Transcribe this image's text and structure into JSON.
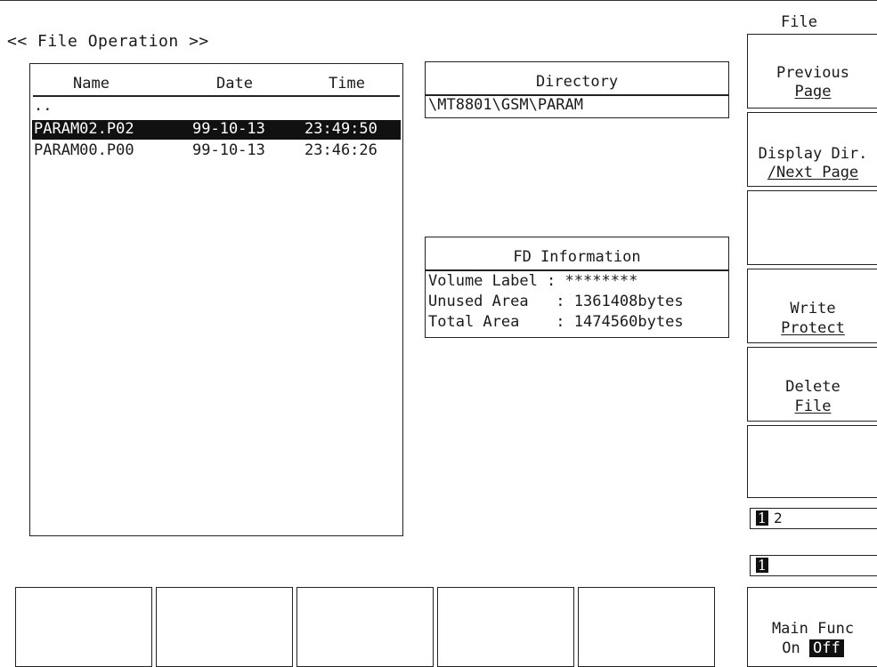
{
  "screen": {
    "title": "<< File Operation >>",
    "softkey_menu_title": "File"
  },
  "file_list": {
    "columns": {
      "name": "Name",
      "date": "Date",
      "time": "Time"
    },
    "parent_entry": "..",
    "rows": [
      {
        "name": "PARAM02.P02",
        "date": "99-10-13",
        "time": "23:49:50",
        "selected": true
      },
      {
        "name": "PARAM00.P00",
        "date": "99-10-13",
        "time": "23:46:26",
        "selected": false
      }
    ]
  },
  "directory": {
    "title": "Directory",
    "path": "\\MT8801\\GSM\\PARAM"
  },
  "fd_info": {
    "title": "FD Information",
    "volume_label": "Volume Label : ********",
    "unused_area": "Unused Area   : 1361408bytes",
    "total_area": "Total Area    : 1474560bytes"
  },
  "softkeys": {
    "previous_page_line1": "Previous",
    "previous_page_line2": "Page",
    "display_dir_line1": "Display Dir.",
    "display_dir_line2": "/Next Page",
    "write_protect_line1": "Write",
    "write_protect_line2": "Protect",
    "delete_file_line1": "Delete",
    "delete_file_line2": "File",
    "page_indicator_current": "1",
    "page_indicator_other": "2",
    "level_indicator": "1",
    "main_func_label": "Main Func",
    "main_func_on": "On",
    "main_func_off": "Off"
  }
}
